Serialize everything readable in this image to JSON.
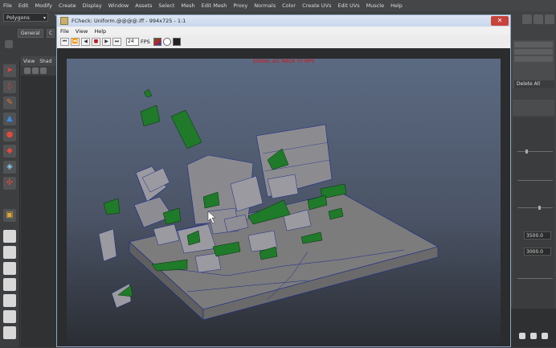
{
  "maya_menu": [
    "File",
    "Edit",
    "Modify",
    "Create",
    "Display",
    "Window",
    "Assets",
    "Select",
    "Mesh",
    "Edit Mesh",
    "Proxy",
    "Normals",
    "Color",
    "Create UVs",
    "Edit UVs",
    "Muscle",
    "Help"
  ],
  "mode_select": {
    "value": "Polygons"
  },
  "shelf_tabs": [
    "General",
    "C"
  ],
  "viewport_menu": [
    "View",
    "Shad"
  ],
  "right_panel": {
    "delete_all_label": "Delete All",
    "field_1": "3500.0",
    "field_2": "3000.0"
  },
  "fcheck": {
    "title": "FCheck: Uniform.@@@@.iff - 994x725 - 1:1",
    "close_glyph": "✕",
    "menu": [
      "File",
      "View",
      "Help"
    ],
    "fps_value": "24",
    "fps_label": "FPS",
    "scene_label": "SIGNAL   at1 MASK 70 MPS"
  },
  "colors": {
    "viewport_bg_top": "#5b6a82",
    "viewport_bg_bottom": "#2a2d33",
    "slab": "#7c7c7c",
    "debris_gray": "#9a9aa0",
    "debris_green": "#1f7a2a",
    "wire": "#1c2a8a"
  },
  "icons": [
    "select-arrow-icon",
    "lasso-icon",
    "paint-icon",
    "move-icon",
    "rotate-icon",
    "scale-icon",
    "soft-mod-icon",
    "show-manipulator-icon",
    "cube-icon",
    "layout-single-icon",
    "layout-four-icon",
    "layout-side-icon",
    "layout-stack-icon",
    "layout-persp-icon",
    "layout-graph-icon",
    "layout-outliner-icon"
  ]
}
